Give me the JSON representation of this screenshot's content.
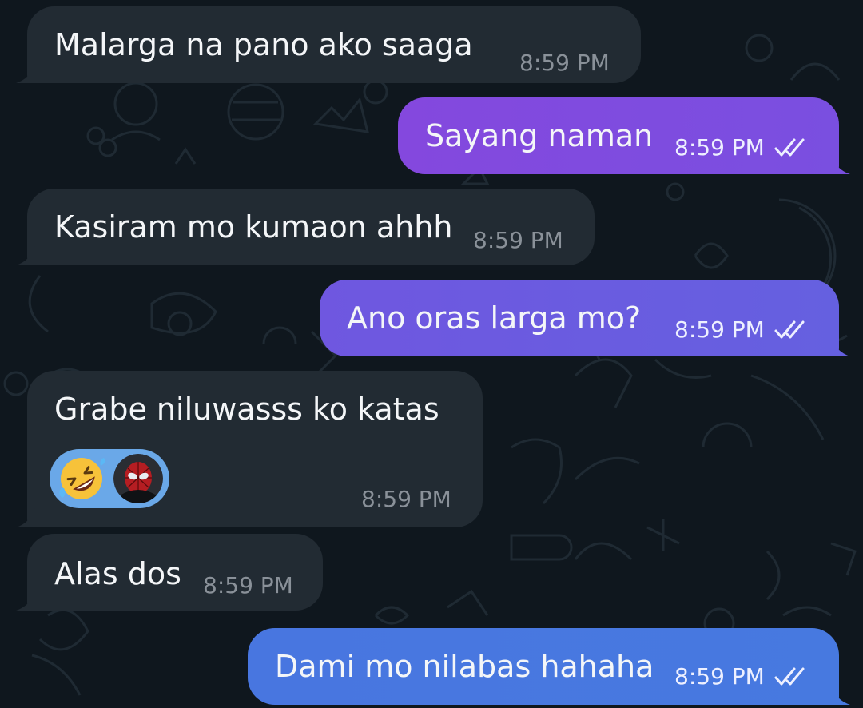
{
  "messages": [
    {
      "direction": "in",
      "text": "Malarga na pano ako saaga",
      "time": "8:59 PM"
    },
    {
      "direction": "out",
      "text": "Sayang naman",
      "time": "8:59 PM",
      "status": "double-check-read"
    },
    {
      "direction": "in",
      "text": "Kasiram mo kumaon ahhh",
      "time": "8:59 PM"
    },
    {
      "direction": "out",
      "text": "Ano oras larga mo?",
      "time": "8:59 PM",
      "status": "double-check-read"
    },
    {
      "direction": "in",
      "text": "Grabe niluwasss ko katas",
      "time": "8:59 PM",
      "reactions": {
        "emoji": "rolling-on-floor-laughing",
        "reactor_avatar": "spiderman-avatar"
      }
    },
    {
      "direction": "in",
      "text": "Alas dos",
      "time": "8:59 PM"
    },
    {
      "direction": "out",
      "text": "Dami mo nilabas hahaha",
      "time": "8:59 PM",
      "status": "double-check-read"
    }
  ],
  "colors": {
    "background": "#0f171e",
    "incoming_bubble": "#222b33",
    "outgoing_gradient_top": "#8a45df",
    "outgoing_gradient_mid": "#6a5be0",
    "outgoing_gradient_bottom": "#4577e0",
    "reaction_pill": "#6aa8e8",
    "timestamp_incoming": "#8a9199",
    "timestamp_outgoing": "#eef0ff"
  }
}
